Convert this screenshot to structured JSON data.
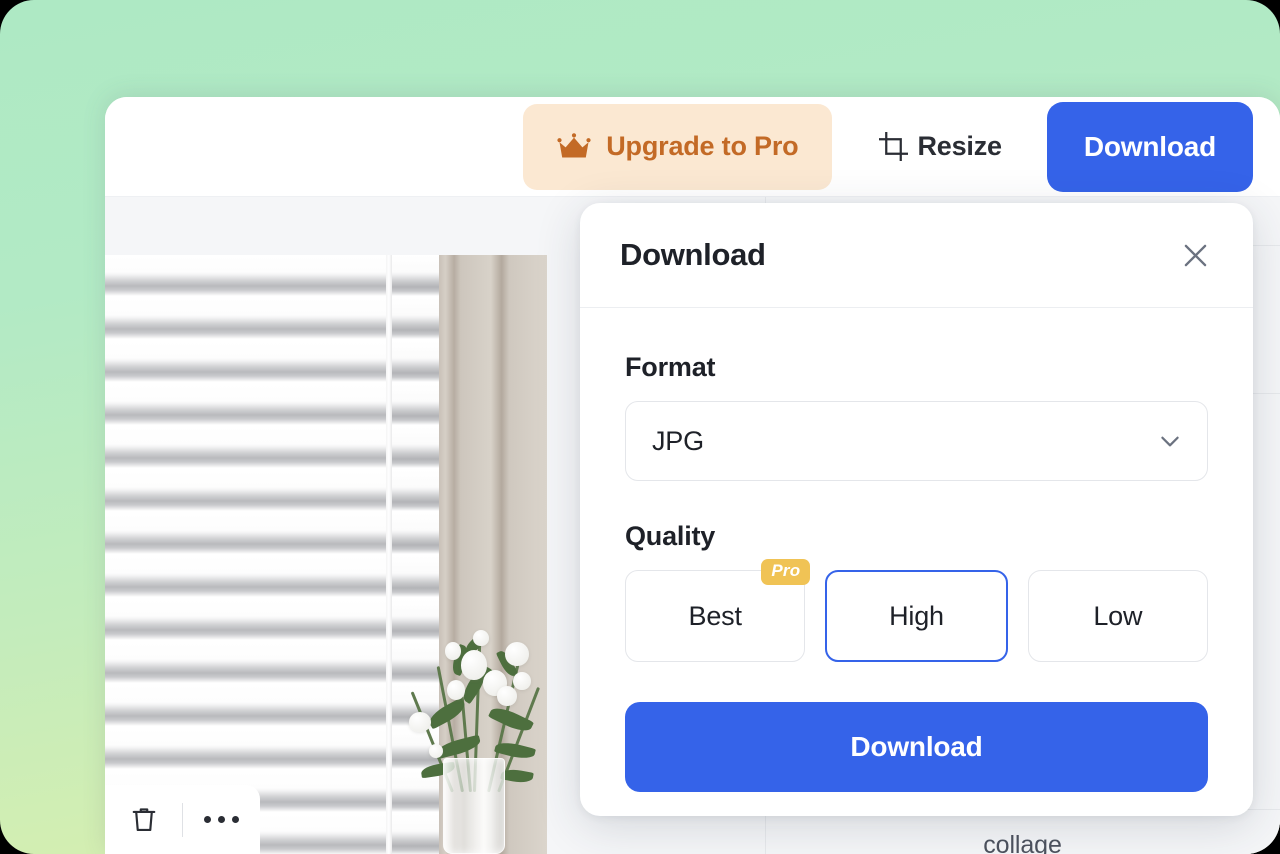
{
  "app": {
    "toolbar": {
      "upgrade_label": "Upgrade to Pro",
      "upgrade_icon": "crown-icon",
      "resize_label": "Resize",
      "resize_icon": "crop-resize-icon",
      "download_label": "Download"
    },
    "canvas": {
      "image_description": "White venetian blinds beside a beige wall with a bouquet of white flowers in a clear glass vase"
    },
    "bottom_toolbar": {
      "delete_icon": "trash-icon",
      "more_icon": "ellipsis-icon"
    },
    "right_rail": {
      "caption": "collage"
    }
  },
  "modal": {
    "title": "Download",
    "close_icon": "close-icon",
    "format": {
      "label": "Format",
      "selected": "JPG",
      "chevron_icon": "chevron-down-icon"
    },
    "quality": {
      "label": "Quality",
      "options": [
        {
          "label": "Best",
          "selected": false,
          "badge": "Pro"
        },
        {
          "label": "High",
          "selected": true,
          "badge": ""
        },
        {
          "label": "Low",
          "selected": false,
          "badge": ""
        }
      ]
    },
    "submit_label": "Download"
  },
  "colors": {
    "accent_blue": "#3563e9",
    "pro_gold": "#f0c355",
    "upgrade_bg": "#fbe8d2",
    "upgrade_text": "#c36a26",
    "background_top": "#aee9c4",
    "background_bottom": "#dff2ae"
  }
}
